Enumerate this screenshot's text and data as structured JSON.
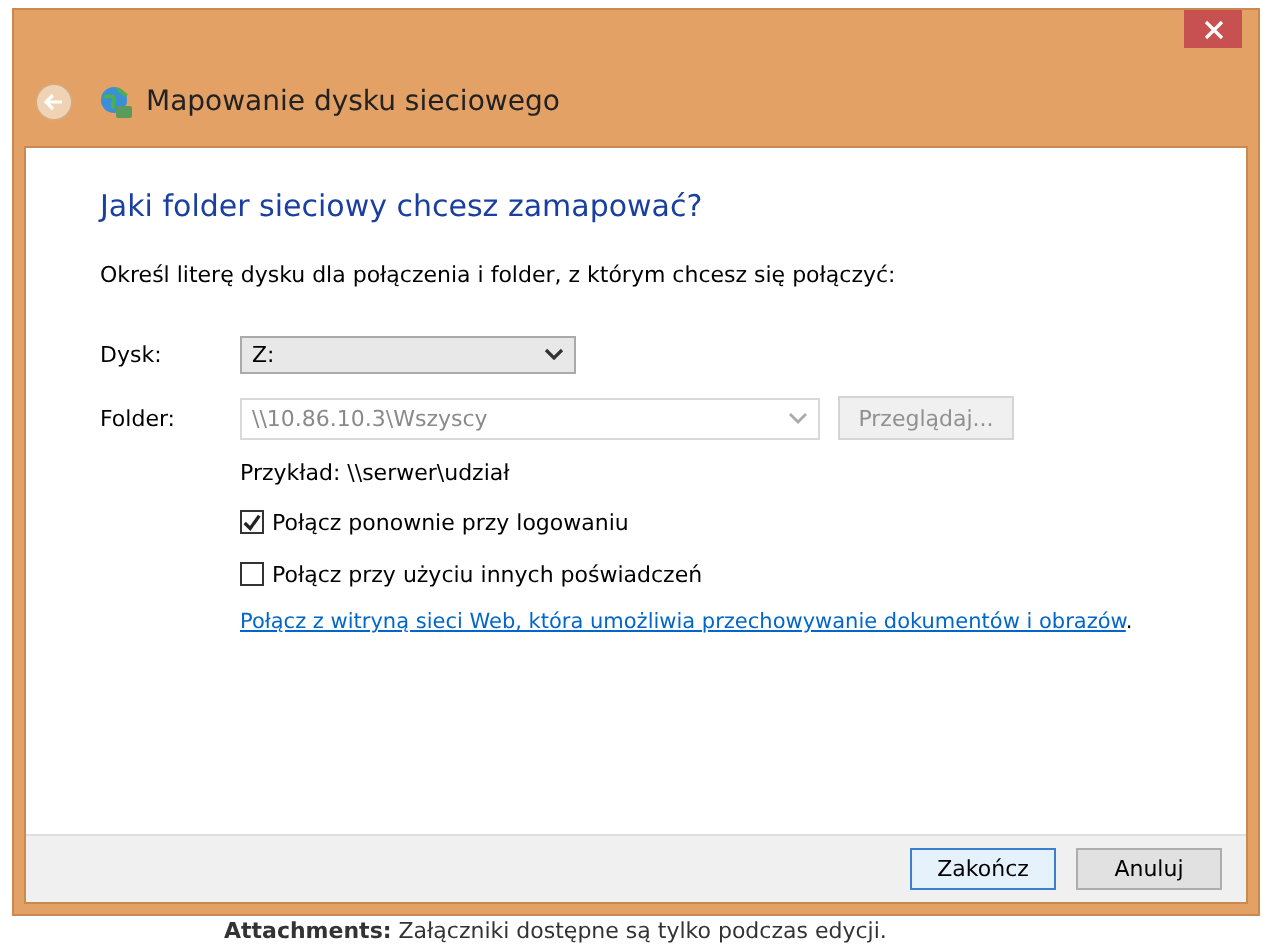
{
  "window": {
    "title": "Mapowanie dysku sieciowego"
  },
  "heading": "Jaki folder sieciowy chcesz zamapować?",
  "instruction": "Określ literę dysku dla połączenia i folder, z którym chcesz się połączyć:",
  "drive": {
    "label": "Dysk:",
    "value": "Z:"
  },
  "folder": {
    "label": "Folder:",
    "value": "\\\\10.86.10.3\\Wszyscy",
    "disabled": true,
    "browse_button": "Przeglądaj..."
  },
  "example": "Przykład: \\\\serwer\\udział",
  "options": [
    {
      "label": "Połącz ponownie przy logowaniu",
      "checked": true
    },
    {
      "label": "Połącz przy użyciu innych poświadczeń",
      "checked": false
    }
  ],
  "link": {
    "text": "Połącz z witryną sieci Web, która umożliwia przechowywanie dokumentów i obrazów",
    "after": "."
  },
  "buttons": [
    {
      "label": "Zakończ",
      "default": true
    },
    {
      "label": "Anuluj",
      "default": false
    }
  ],
  "background_text": {
    "bold": "Attachments:",
    "text": "Załączniki dostępne są tylko podczas edycji."
  }
}
